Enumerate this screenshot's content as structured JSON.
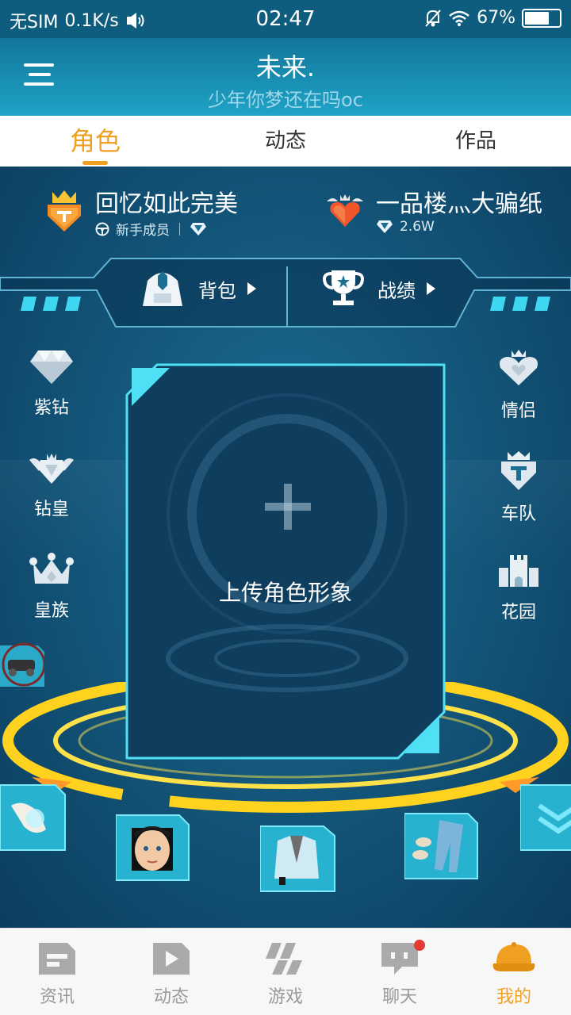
{
  "status_bar": {
    "carrier": "无SIM",
    "speed": "0.1K/s",
    "time": "02:47",
    "battery": "67%",
    "icons": [
      "vibrate-icon",
      "mute-bell-icon",
      "wifi-icon",
      "battery-icon"
    ]
  },
  "header": {
    "title": "未来.",
    "subtitle": "少年你梦还在吗oc",
    "menu_icon": "menu-icon"
  },
  "tabs": [
    {
      "label": "角色",
      "active": true
    },
    {
      "label": "动态",
      "active": false
    },
    {
      "label": "作品",
      "active": false
    }
  ],
  "profile": {
    "left": {
      "name": "回忆如此完美",
      "rank": "新手成员",
      "icon": "team-crown-badge-icon"
    },
    "right": {
      "name": "一品楼灬大骗纸",
      "value": "2.6W",
      "icon": "heart-wings-badge-icon"
    }
  },
  "actions": {
    "bag": {
      "label": "背包",
      "icon": "robot-bag-icon"
    },
    "record": {
      "label": "战绩",
      "icon": "trophy-icon"
    }
  },
  "left_side": [
    {
      "label": "紫钻",
      "icon": "diamond-icon"
    },
    {
      "label": "钻皇",
      "icon": "winged-diamond-icon"
    },
    {
      "label": "皇族",
      "icon": "crown-icon"
    }
  ],
  "right_side": [
    {
      "label": "情侣",
      "icon": "couple-heart-icon"
    },
    {
      "label": "车队",
      "icon": "team-shield-icon"
    },
    {
      "label": "花园",
      "icon": "castle-icon"
    }
  ],
  "card": {
    "label": "上传角色形象",
    "icon": "plus-icon"
  },
  "equipment": [
    {
      "name": "glove-slot-icon"
    },
    {
      "name": "face-slot-icon"
    },
    {
      "name": "outfit-slot-icon"
    },
    {
      "name": "pants-shoes-slot-icon"
    },
    {
      "name": "expand-slot-icon"
    }
  ],
  "bottom_nav": [
    {
      "label": "资讯",
      "icon": "news-icon",
      "active": false
    },
    {
      "label": "动态",
      "icon": "play-icon",
      "active": false
    },
    {
      "label": "游戏",
      "icon": "game-icon",
      "active": false
    },
    {
      "label": "聊天",
      "icon": "chat-icon",
      "active": false,
      "badge": true
    },
    {
      "label": "我的",
      "icon": "cap-icon",
      "active": true
    }
  ],
  "colors": {
    "accent": "#f0a020",
    "header": "#1fa3c7",
    "scene": "#145a7e",
    "cyan": "#3fd6f2",
    "ring": "#ffd21f"
  }
}
